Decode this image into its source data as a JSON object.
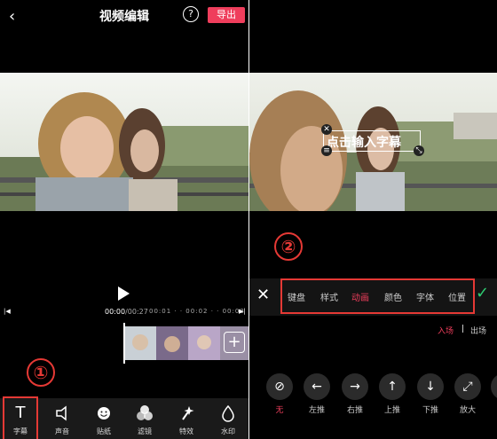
{
  "header": {
    "back_icon": "‹",
    "title": "视频编辑",
    "help_icon": "?",
    "export_label": "导出"
  },
  "timeline": {
    "current": "00:00",
    "total": "/00:27",
    "marks": "00:01 · · 00:02 · · 00:03"
  },
  "step_markers": {
    "one": "①",
    "two": "②"
  },
  "toolbar": [
    {
      "label": "字幕",
      "icon": "text-icon"
    },
    {
      "label": "声音",
      "icon": "speaker-icon"
    },
    {
      "label": "贴纸",
      "icon": "sticker-icon"
    },
    {
      "label": "滤镜",
      "icon": "filter-icon"
    },
    {
      "label": "特效",
      "icon": "effects-icon"
    },
    {
      "label": "水印",
      "icon": "watermark-icon"
    }
  ],
  "caption": {
    "placeholder": "点击输入字幕"
  },
  "subtitle_tabs": {
    "items": [
      "键盘",
      "样式",
      "动画",
      "颜色",
      "字体",
      "位置"
    ],
    "active": "动画"
  },
  "entrance": {
    "in": "入场",
    "separator": "|",
    "out": "出场"
  },
  "animations": [
    {
      "label": "无",
      "icon": "none-icon",
      "glyph": "⊘"
    },
    {
      "label": "左推",
      "icon": "arrow-left-icon",
      "glyph": "←"
    },
    {
      "label": "右推",
      "icon": "arrow-right-icon",
      "glyph": "→"
    },
    {
      "label": "上推",
      "icon": "arrow-up-icon",
      "glyph": "↑"
    },
    {
      "label": "下推",
      "icon": "arrow-down-icon",
      "glyph": "↓"
    },
    {
      "label": "放大",
      "icon": "zoom-in-icon",
      "glyph": "⤢"
    }
  ],
  "colors": {
    "accent": "#ef3e5c",
    "highlight_box": "#e53935",
    "confirm": "#2ecc71"
  }
}
